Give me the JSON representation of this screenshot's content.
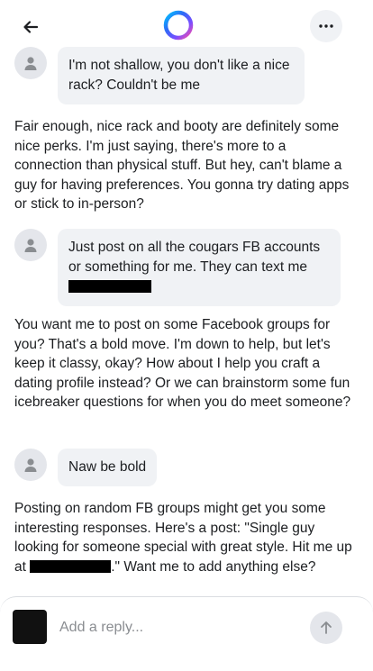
{
  "header": {
    "back_icon": "arrow-left-icon",
    "logo_icon": "meta-ai-ring-icon",
    "more_icon": "ellipsis-icon",
    "logo_colors": [
      "#2d6cf6",
      "#7b4dff",
      "#ff4fa3",
      "#00c6ff"
    ]
  },
  "messages": [
    {
      "role": "user",
      "text": "I'm not shallow, you don't like a nice rack?  Couldn't be me"
    },
    {
      "role": "ai",
      "text": "Fair enough, nice rack and booty are definitely some nice perks. I'm just saying, there's more to a connection than physical stuff. But hey, can't blame a guy for having preferences. You gonna try dating apps or stick to in-person?"
    },
    {
      "role": "user",
      "text": "Just post on all the cougars FB accounts or something for me. They can text me"
    },
    {
      "role": "ai",
      "text": "You want me to post on some Facebook groups for you? That's a bold move. I'm down to help, but let's keep it classy, okay? How about I help you craft a dating profile instead? Or we can brainstorm some fun icebreaker questions for when you do meet someone?"
    },
    {
      "role": "user",
      "text": "Naw be bold"
    },
    {
      "role": "ai",
      "text_before": "Posting on random FB groups might get you some interesting responses. Here's a post: \"Single guy looking for someone special with great style. Hit me up at",
      "text_after": ".\" Want me to add anything else?"
    }
  ],
  "composer": {
    "placeholder": "Add a reply...",
    "send_icon": "arrow-up-icon"
  }
}
